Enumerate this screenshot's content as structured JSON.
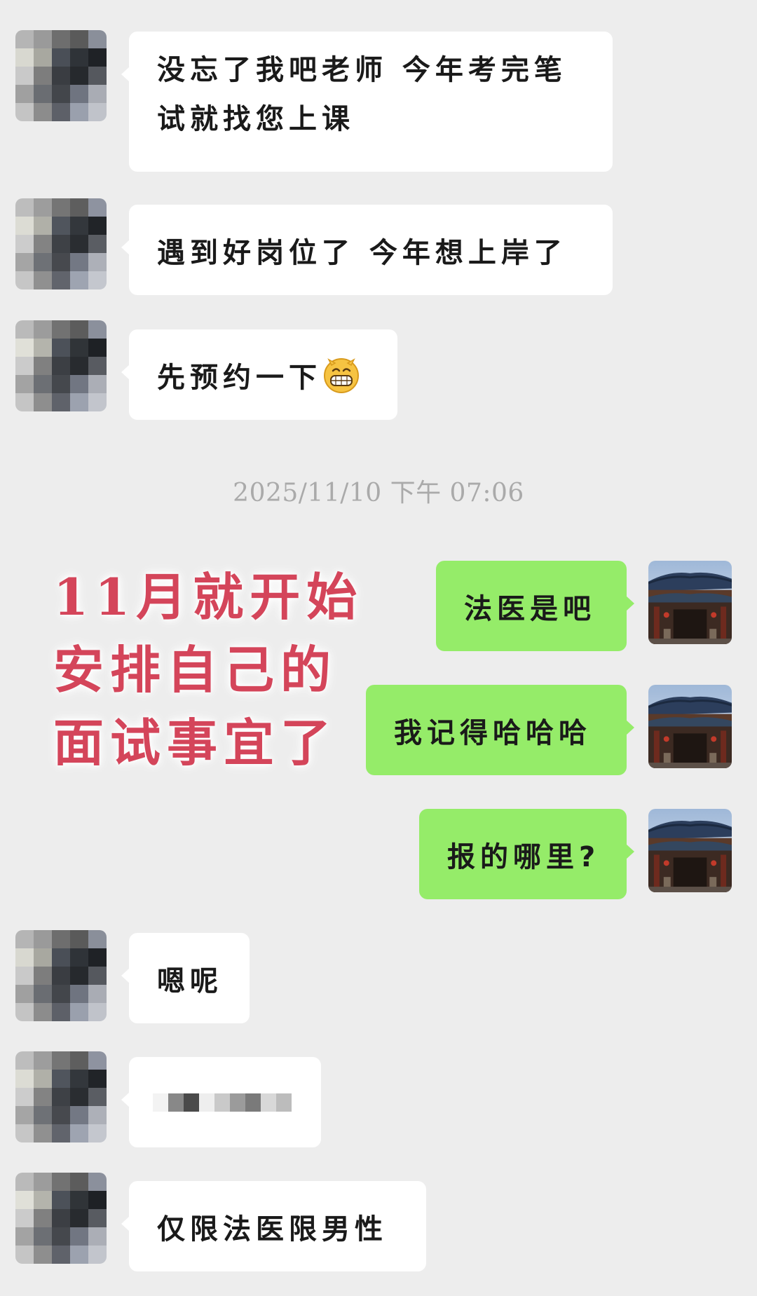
{
  "messages": [
    {
      "from": "other",
      "text": "没忘了我吧老师 今年考完笔试就找您上课",
      "line1": "没忘了我吧老师 今年考完笔",
      "line2": "试就找您上课"
    },
    {
      "from": "other",
      "text": "遇到好岗位了 今年想上岸了"
    },
    {
      "from": "other",
      "text": "先预约一下",
      "emoji": "grinning-face-emoji"
    },
    {
      "from": "me",
      "text": "法医是吧"
    },
    {
      "from": "me",
      "text": "我记得哈哈哈"
    },
    {
      "from": "me",
      "text": "报的哪里?"
    },
    {
      "from": "other",
      "text": "嗯呢"
    },
    {
      "from": "other",
      "text": "",
      "note": "pixelated"
    },
    {
      "from": "other",
      "text": "仅限法医限男性"
    }
  ],
  "timestamp": "2025/11/10 下午 07:06",
  "overlay": {
    "lines": [
      "11月就开始",
      "安排自己的",
      "面试事宜了"
    ],
    "color": "#d4455a"
  },
  "colors": {
    "background": "#ededed",
    "incoming_bubble": "#ffffff",
    "outgoing_bubble": "#95ec69"
  }
}
